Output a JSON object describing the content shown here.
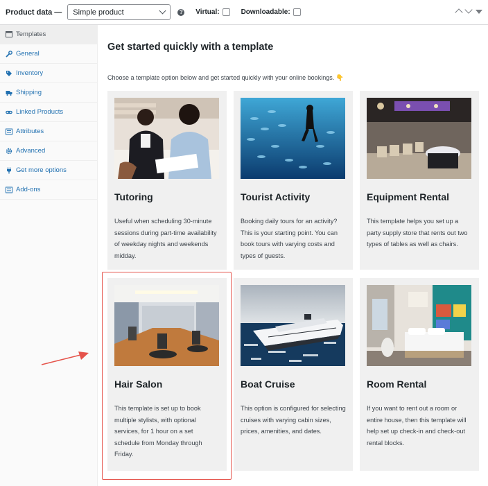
{
  "header": {
    "label": "Product data —",
    "product_type": "Simple product",
    "help": "?",
    "virtual_label": "Virtual:",
    "downloadable_label": "Downloadable:"
  },
  "sidebar": {
    "items": [
      {
        "label": "Templates",
        "icon": "templates-icon",
        "active": true
      },
      {
        "label": "General",
        "icon": "wrench-icon"
      },
      {
        "label": "Inventory",
        "icon": "tag-icon"
      },
      {
        "label": "Shipping",
        "icon": "truck-icon"
      },
      {
        "label": "Linked Products",
        "icon": "link-icon"
      },
      {
        "label": "Attributes",
        "icon": "list-icon"
      },
      {
        "label": "Advanced",
        "icon": "gear-icon"
      },
      {
        "label": "Get more options",
        "icon": "plug-icon"
      },
      {
        "label": "Add-ons",
        "icon": "list-icon"
      }
    ]
  },
  "main": {
    "title": "Get started quickly with a template",
    "subtitle": "Choose a template option below and get started quickly with your online bookings. 👇",
    "cards": [
      {
        "title": "Tutoring",
        "desc": "Useful when scheduling 30-minute sessions during part-time availability of weekday nights and weekends midday."
      },
      {
        "title": "Tourist Activity",
        "desc": "Booking daily tours for an activity? This is your starting point. You can book tours with varying costs and types of guests."
      },
      {
        "title": "Equipment Rental",
        "desc": "This template helps you set up a party supply store that rents out two types of tables as well as chairs."
      },
      {
        "title": "Hair Salon",
        "desc": "This template is set up to book multiple stylists, with optional services, for 1 hour on a set schedule from Monday through Friday."
      },
      {
        "title": "Boat Cruise",
        "desc": "This option is configured for selecting cruises with varying cabin sizes, prices, amenities, and dates."
      },
      {
        "title": "Room Rental",
        "desc": "If you want to rent out a room or entire house, then this template will help set up check-in and check-out rental blocks."
      }
    ]
  },
  "colors": {
    "link": "#2271b1",
    "highlight": "#e5534b",
    "card_bg": "#f0f0f0"
  }
}
